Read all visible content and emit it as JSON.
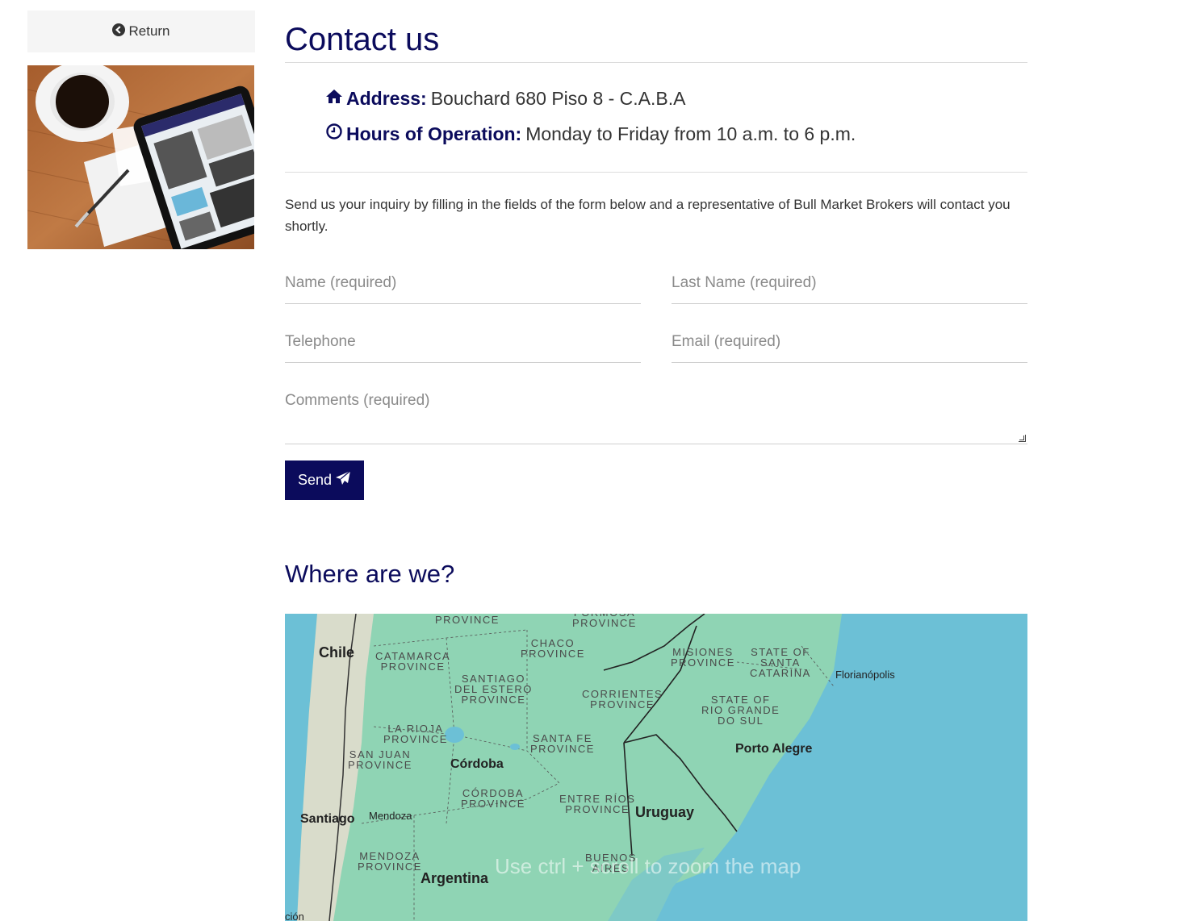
{
  "sidebar": {
    "return_label": "Return"
  },
  "main": {
    "title": "Contact us",
    "address_label": "Address:",
    "address_value": "Bouchard 680 Piso 8 - C.A.B.A",
    "hours_label": "Hours of Operation:",
    "hours_value": "Monday to Friday from 10 a.m. to 6 p.m.",
    "intro": "Send us your inquiry by filling in the fields of the form below and a representative of Bull Market Brokers will contact you shortly."
  },
  "form": {
    "name_placeholder": "Name (required)",
    "lastname_placeholder": "Last Name (required)",
    "telephone_placeholder": "Telephone",
    "email_placeholder": "Email (required)",
    "comments_placeholder": "Comments (required)",
    "send_label": "Send"
  },
  "location": {
    "title": "Where are we?"
  },
  "map": {
    "regions": [
      "PROVINCE",
      "FORMOSA\nPROVINCE",
      "CHACO\nPROVINCE",
      "MISIONES\nPROVINCE",
      "STATE OF\nSANTA\nCATARINA",
      "CATAMARCA\nPROVINCE",
      "SANTIAGO\nDEL ESTERO\nPROVINCE",
      "CORRIENTES\nPROVINCE",
      "STATE OF\nRIO GRANDE\nDO SUL",
      "LA RIOJA\nPROVINCE",
      "SANTA FE\nPROVINCE",
      "SAN JUAN\nPROVINCE",
      "CÓRDOBA\nPROVINCE",
      "ENTRE RÍOS\nPROVINCE",
      "MENDOZA\nPROVINCE",
      "BUENOS\nAIRES"
    ],
    "countries": [
      "Chile",
      "Uruguay",
      "Argentina"
    ],
    "cities": [
      "Córdoba",
      "Porto Alegre",
      "Santiago"
    ],
    "small_cities": [
      "Florianópolis",
      "Mendoza",
      "ción"
    ],
    "hint": "Use ctrl + scroll to zoom the map"
  },
  "colors": {
    "brand": "#0b0b5c",
    "button_bg": "#0b0b5c",
    "return_bg": "#f5f5f5",
    "map_land": "#8fd4b4",
    "map_sea": "#6cc0d6"
  }
}
